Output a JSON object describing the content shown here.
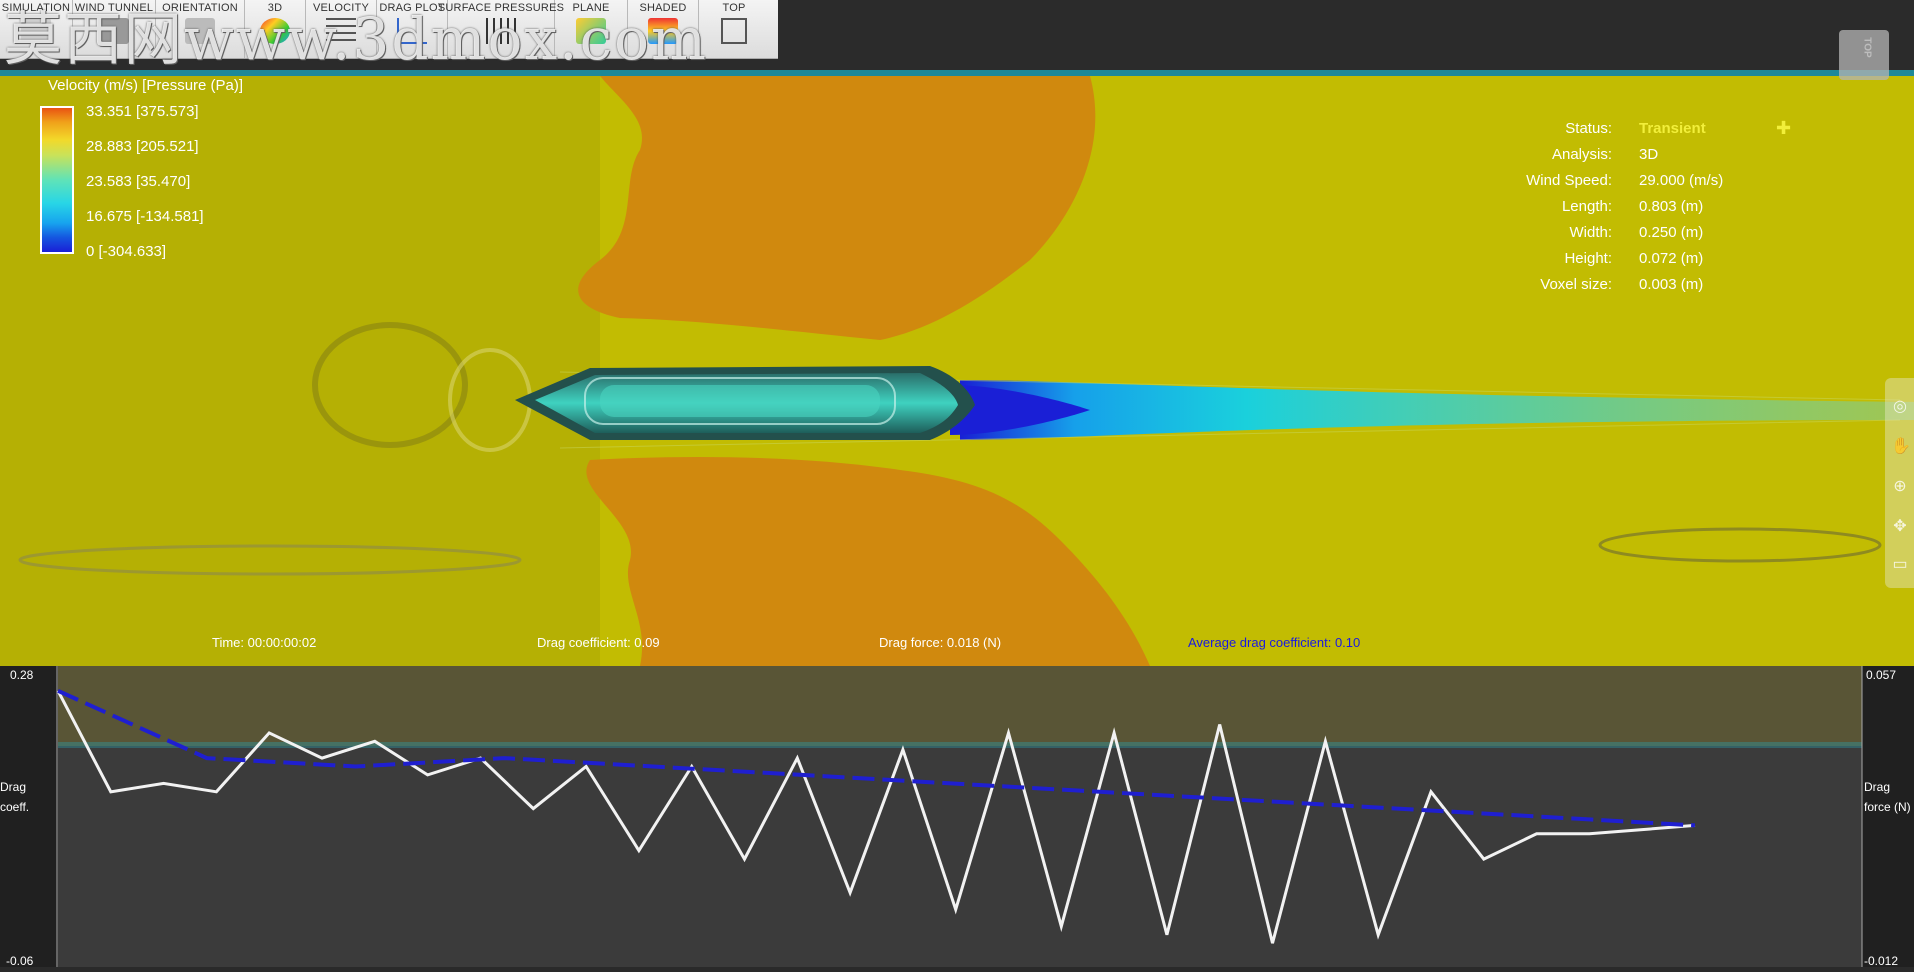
{
  "toolbar": {
    "items": [
      {
        "label": "SIMULATION",
        "icon": "simulation-icon"
      },
      {
        "label": "WIND TUNNEL",
        "icon": "wind-tunnel-icon"
      },
      {
        "label": "ORIENTATION",
        "icon": "orientation-icon"
      },
      {
        "label": "3D",
        "icon": "3d-icon"
      },
      {
        "label": "VELOCITY",
        "icon": "velocity-icon"
      },
      {
        "label": "DRAG PLOT",
        "icon": "drag-plot-icon"
      },
      {
        "label": "SURFACE PRESSURES",
        "icon": "surface-pressures-icon"
      },
      {
        "label": "PLANE",
        "icon": "plane-icon"
      },
      {
        "label": "SHADED",
        "icon": "shaded-icon"
      },
      {
        "label": "TOP",
        "icon": "cube-icon"
      }
    ]
  },
  "watermark": "莫西网www.3dmox.com",
  "legend": {
    "title": "Velocity (m/s) [Pressure (Pa)]",
    "values": [
      "33.351 [375.573]",
      "28.883 [205.521]",
      "23.583 [35.470]",
      "16.675 [-134.581]",
      "0 [-304.633]"
    ]
  },
  "status_panel": {
    "rows": [
      {
        "key": "Status:",
        "value": "Transient"
      },
      {
        "key": "Analysis:",
        "value": "3D"
      },
      {
        "key": "Wind Speed:",
        "value": "29.000 (m/s)"
      },
      {
        "key": "Length:",
        "value": "0.803 (m)"
      },
      {
        "key": "Width:",
        "value": "0.250 (m)"
      },
      {
        "key": "Height:",
        "value": "0.072 (m)"
      },
      {
        "key": "Voxel size:",
        "value": "0.003 (m)"
      }
    ],
    "status_color": "#f2ef3a"
  },
  "view_cube": {
    "label": "TOP"
  },
  "metrics": {
    "time": "Time: 00:00:00:02",
    "drag_coefficient": "Drag coefficient: 0.09",
    "drag_force": "Drag force: 0.018 (N)",
    "average_drag": "Average drag coefficient: 0.10"
  },
  "chart": {
    "left_axis": {
      "label_line1": "Drag",
      "label_line2": "coeff.",
      "max": "0.28",
      "min": "-0.06"
    },
    "right_axis": {
      "label_line1": "Drag",
      "label_line2": "force (N)",
      "max": "0.057",
      "min": "-0.012"
    }
  },
  "colors": {
    "field_yellow": "#c5c000",
    "high_orange": "#d08a10",
    "wake_cyan": "#19c8d8",
    "wake_blue": "#1a1fd6",
    "drag_line": "#f2f2f2",
    "average_line": "#1f1fd0"
  },
  "chart_data": {
    "type": "line",
    "ylabel": "Drag coeff.",
    "ylim": [
      -0.06,
      0.28
    ],
    "y2label": "Drag force (N)",
    "y2lim": [
      -0.012,
      0.057
    ],
    "series": [
      {
        "values": [
          0.26,
          0.14,
          0.15,
          0.14,
          0.21,
          0.18,
          0.2,
          0.16,
          0.18,
          0.12,
          0.17,
          0.07,
          0.17,
          0.06,
          0.18,
          0.02,
          0.19,
          0.0,
          0.21,
          -0.02,
          0.21,
          -0.03,
          0.22,
          -0.04,
          0.2,
          -0.03,
          0.14,
          0.06,
          0.09,
          0.09,
          0.095,
          0.1
        ]
      },
      {
        "values": [
          0.26,
          0.18,
          0.17,
          0.18,
          0.17,
          0.16,
          0.15,
          0.14,
          0.13,
          0.12,
          0.11,
          0.1
        ]
      }
    ]
  }
}
